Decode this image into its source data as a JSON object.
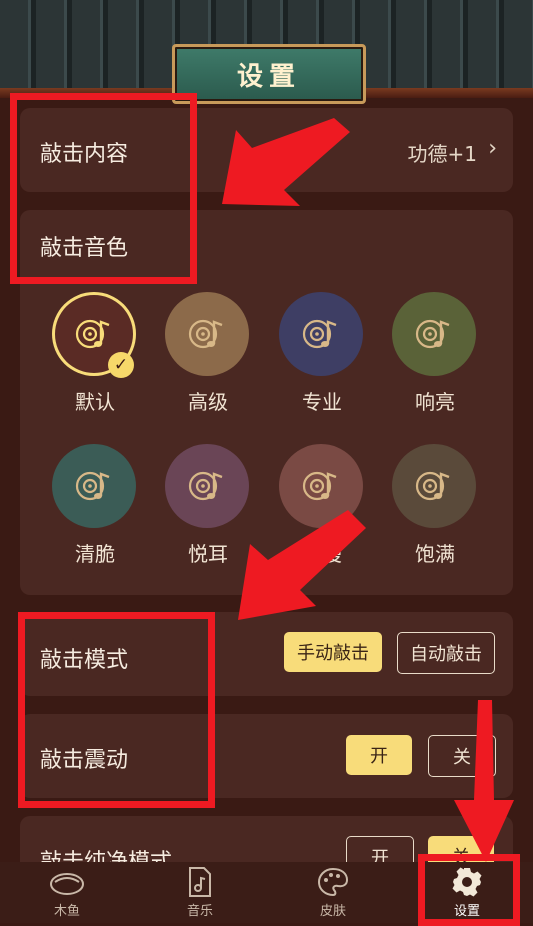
{
  "header": {
    "title": "设置"
  },
  "tap_content": {
    "label": "敲击内容",
    "value": "功德+1",
    "chevron": "›"
  },
  "tap_tone": {
    "label": "敲击音色",
    "options": [
      {
        "name": "默认",
        "color": "#5a2b25",
        "selected": true
      },
      {
        "name": "高级",
        "color": "#8c6a4a"
      },
      {
        "name": "专业",
        "color": "#3e3e64"
      },
      {
        "name": "响亮",
        "color": "#5a6238"
      },
      {
        "name": "清脆",
        "color": "#3b5c56"
      },
      {
        "name": "悦耳",
        "color": "#6a4556"
      },
      {
        "name": "浪漫",
        "color": "#7a4a44"
      },
      {
        "name": "饱满",
        "color": "#5a4a3a"
      }
    ],
    "check": "✓"
  },
  "tap_mode": {
    "label": "敲击模式",
    "manual": "手动敲击",
    "auto": "自动敲击"
  },
  "tap_vibration": {
    "label": "敲击震动",
    "on": "开",
    "off": "关"
  },
  "pure_mode": {
    "label": "敲击纯净模式",
    "on": "开",
    "off": "关"
  },
  "tabs": [
    {
      "label": "木鱼",
      "icon": "wooden-fish-icon"
    },
    {
      "label": "音乐",
      "icon": "music-file-icon"
    },
    {
      "label": "皮肤",
      "icon": "palette-icon"
    },
    {
      "label": "设置",
      "icon": "gear-icon"
    }
  ],
  "colors": {
    "accent": "#f8dc7a",
    "annotation": "#ee1a22",
    "panel": "#4a2822"
  }
}
